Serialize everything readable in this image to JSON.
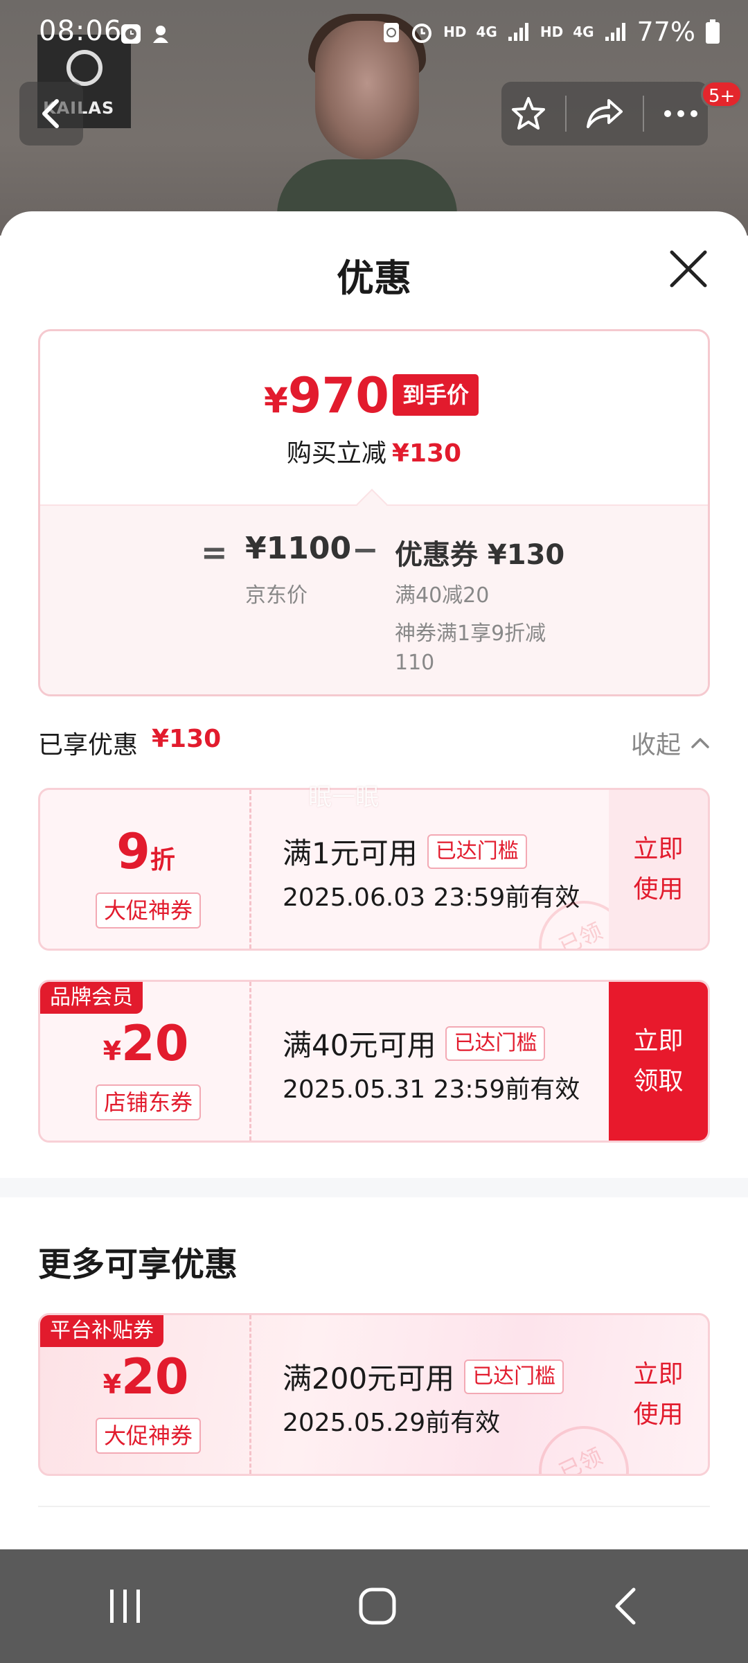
{
  "status_bar": {
    "time": "08:06",
    "hd1": "HD",
    "net1": "4G",
    "hd2": "HD",
    "net2": "4G",
    "battery": "77%"
  },
  "header": {
    "brand_logo_text": "KAILAS",
    "more_badge": "5+"
  },
  "sheet": {
    "title": "优惠",
    "price_card": {
      "final_yen": "¥",
      "final_price": "970",
      "final_tag": "到手价",
      "reduce_label": "购买立减",
      "reduce_amount": "¥130",
      "eq": "=",
      "jd_price": "¥1100",
      "jd_label": "京东价",
      "minus": "−",
      "coupon_label": "优惠券 ¥130",
      "coupon_sub1": "满40减20",
      "coupon_sub2": "神券满1享9折减110"
    },
    "enjoyed": {
      "label": "已享优惠",
      "amount": "¥130",
      "collapse": "收起"
    },
    "coupons": [
      {
        "amount": "9",
        "unit": "折",
        "kind": "大促神券",
        "condition": "满1元可用",
        "reached": "已达门槛",
        "validity": "2025.06.03 23:59前有效",
        "action_line1": "立即",
        "action_line2": "使用",
        "stamp": "已领"
      },
      {
        "corner_tag": "品牌会员",
        "yen": "¥",
        "amount": "20",
        "kind": "店铺东券",
        "condition": "满40元可用",
        "reached": "已达门槛",
        "validity": "2025.05.31 23:59前有效",
        "action_line1": "立即",
        "action_line2": "领取"
      }
    ],
    "more_title": "更多可享优惠",
    "more_coupons": [
      {
        "corner_tag": "平台补贴券",
        "yen": "¥",
        "amount": "20",
        "kind": "大促神券",
        "condition": "满200元可用",
        "reached": "已达门槛",
        "validity": "2025.05.29前有效",
        "action_line1": "立即",
        "action_line2": "使用",
        "stamp": "已领"
      }
    ],
    "watermark": "眠一眠"
  }
}
